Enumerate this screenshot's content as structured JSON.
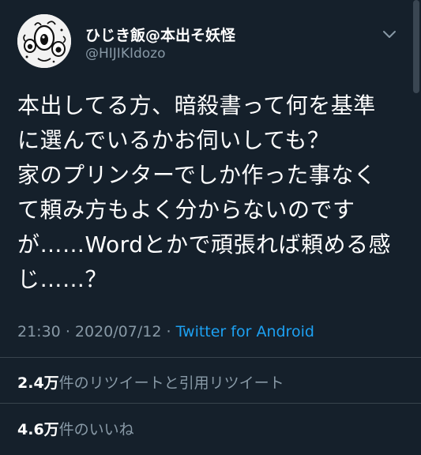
{
  "user": {
    "display_name": "ひじき飯@本出そ妖怪",
    "handle": "@HIJIKIdozo"
  },
  "tweet": {
    "lines": [
      "本出してる方、暗殺書って何を基準",
      "に選んでいるかお伺いしても？",
      "家のプリンターでしか作った事なく",
      "て頼み方もよく分からないのです",
      "が……Wordとかで頑張れば頼める感",
      "じ……？"
    ],
    "time": "21:30",
    "separator": "·",
    "date": "2020/07/12",
    "source": "Twitter for Android"
  },
  "stats": {
    "retweets_count": "2.4万",
    "retweets_label": "件のリツイートと引用リツイート",
    "likes_count": "4.6万",
    "likes_label": "件のいいね"
  },
  "colors": {
    "background": "#15202b",
    "text": "#ffffff",
    "secondary": "#8899a6",
    "link": "#1da1f2",
    "divider": "#38444d"
  },
  "icons": {
    "menu": "chevron-down-icon"
  }
}
